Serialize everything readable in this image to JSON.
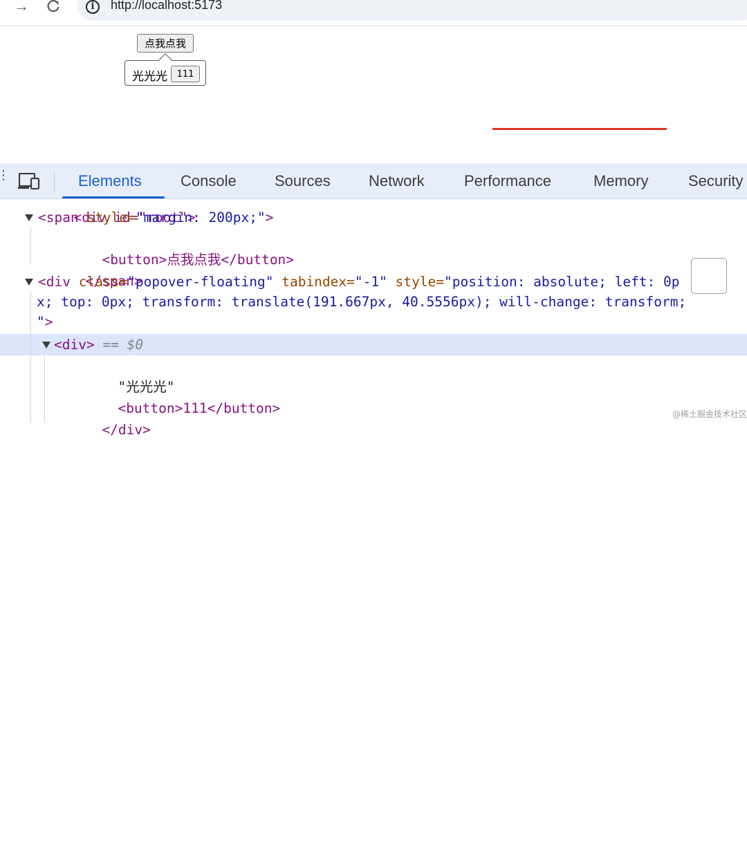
{
  "browser": {
    "url": "http://localhost:5173",
    "forward_icon": "arrow-right-icon",
    "reload_icon": "reload-icon",
    "info_icon": "info-icon"
  },
  "page": {
    "button_label": "点我点我",
    "popover_text": "光光光",
    "popover_button_label": "111"
  },
  "devtools": {
    "tabs": [
      "Elements",
      "Console",
      "Sources",
      "Network",
      "Performance",
      "Memory",
      "Security"
    ],
    "active_tab": "Elements",
    "accent_color": "#1a5fd0",
    "lines": {
      "l0": "<div id=\"root\">",
      "span_open_tag": "<span",
      "span_attr_name": " style=",
      "span_attr_val": "\"margin: 200px;\"",
      "span_close_bracket": ">",
      "button_line": "<button>点我点我</button>",
      "span_close": "</span>",
      "div_open": "<div",
      "div_class_name": " class=",
      "div_class_val": "\"popover-floating\"",
      "div_tabindex_name": " tabindex=",
      "div_tabindex_val": "\"-1\"",
      "div_style_name": " style=",
      "div_style_val_1": "\"position: absolute; left: 0p",
      "div_style_val_2": "x; top: 0px; transform: translate(191.667px, 40.5556px); will-change: transform;",
      "div_style_val_3": "\"",
      "div_end": ">",
      "inner_div": "<div>",
      "selected_marker": " == ",
      "selected_var": "$0",
      "text_node": "\"光光光\"",
      "inner_button": "<button>111</button>",
      "inner_div_close": "</div>"
    }
  },
  "watermark": "@稀土掘金技术社区"
}
